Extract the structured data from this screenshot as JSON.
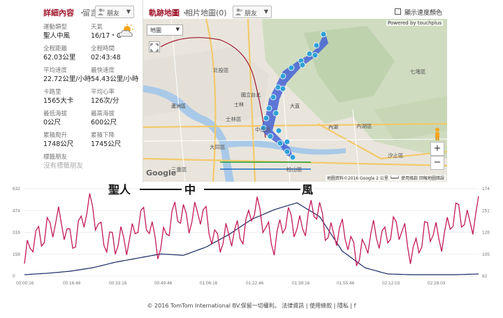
{
  "left_panel": {
    "title": "詳細內容",
    "separator": "・",
    "subtitle": "留言",
    "friend_select": "朋友",
    "stats": [
      {
        "label": "運動類型",
        "value": "聖人中風"
      },
      {
        "label": "天氣",
        "value": "16/17・C"
      },
      {
        "label": "全程距離",
        "value": "62.03公里"
      },
      {
        "label": "全程時間",
        "value": "02:43:48"
      },
      {
        "label": "平均速度",
        "value": "22.72公里/小時"
      },
      {
        "label": "最快速度",
        "value": "54.43公里/小時"
      },
      {
        "label": "卡路里",
        "value": "1565大卡"
      },
      {
        "label": "平均心率",
        "value": "126次/分"
      },
      {
        "label": "最低海拔",
        "value": "0公尺"
      },
      {
        "label": "最高海拔",
        "value": "600公尺"
      },
      {
        "label": "累積爬升",
        "value": "1748公尺"
      },
      {
        "label": "累積下降",
        "value": "1745公尺"
      },
      {
        "label": "標籤朋友",
        "value": "沒有標籤朋友"
      }
    ]
  },
  "map_panel": {
    "title": "軌跡地圖",
    "separator": "・",
    "photos_label": "相片地圖(0)",
    "friend_select": "朋友",
    "speed_toggle": "顯示速度顏色",
    "map_type": "地圖",
    "powered_by": "Powered by touchplus",
    "zoom_in": "+",
    "zoom_out": "−",
    "google": "Google",
    "attribution": "地圖資料©2016 Google   2 公里 ┕━━┙   使用條款   回報地圖錯誤",
    "labels": [
      "北投區",
      "士林區",
      "大同區",
      "中山區",
      "松山區",
      "內湖區",
      "汐止區",
      "七堵區",
      "三重區",
      "蘆洲區",
      "國立台北",
      "大直",
      "內湖",
      "士林"
    ]
  },
  "chart": {
    "title_chars": [
      "聖人",
      "中",
      "風"
    ],
    "accent_colors": {
      "heart_rate": "#c21a5b",
      "elevation": "#1b2a63"
    },
    "left_ticks": [
      "632",
      "474",
      "316",
      "158",
      "0"
    ],
    "right_ticks": [
      "174",
      "151",
      "128",
      "105",
      "82"
    ],
    "x_ticks": [
      "00:00:16",
      "00:16:46",
      "00:33:16",
      "00:49:46",
      "01:06:16",
      "01:22:46",
      "01:39:16",
      "01:55:46",
      "02:12:03",
      "02:28:03"
    ]
  },
  "chart_data": {
    "type": "line",
    "title": "聖人中風",
    "xlabel": "",
    "ylabel": "",
    "x": [
      "00:00:16",
      "00:08:31",
      "00:16:46",
      "00:25:01",
      "00:33:16",
      "00:41:31",
      "00:49:46",
      "00:58:01",
      "01:06:16",
      "01:14:31",
      "01:22:46",
      "01:31:01",
      "01:39:16",
      "01:47:31",
      "01:55:46",
      "02:03:55",
      "02:12:03",
      "02:20:03",
      "02:28:03",
      "02:36:00",
      "02:43:48"
    ],
    "series": [
      {
        "axis": "left",
        "ylim": [
          0,
          632
        ],
        "values": [
          10,
          20,
          35,
          60,
          100,
          130,
          160,
          150,
          210,
          300,
          410,
          480,
          530,
          430,
          180,
          60,
          15,
          10,
          10,
          10,
          15
        ]
      },
      {
        "axis": "right",
        "ylim": [
          82,
          174
        ],
        "values": [
          95,
          140,
          125,
          150,
          108,
          140,
          120,
          152,
          138,
          115,
          150,
          125,
          140,
          145,
          120,
          110,
          135,
          115,
          125,
          140,
          150
        ]
      }
    ]
  },
  "footer": "© 2016 TomTom International BV.保留一切權利。 法律資訊 | 使用條款 | 隱私 | f"
}
